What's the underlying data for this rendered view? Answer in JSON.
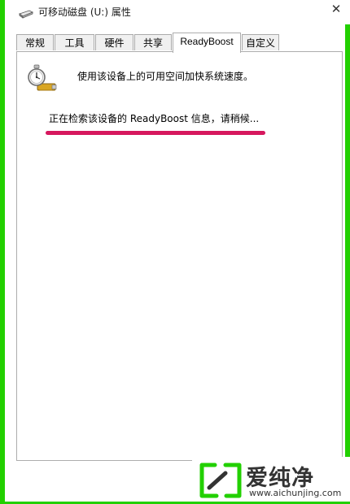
{
  "window": {
    "title": "可移动磁盘 (U:) 属性",
    "close_symbol": "✕"
  },
  "tabs": [
    {
      "label": "常规",
      "active": false
    },
    {
      "label": "工具",
      "active": false
    },
    {
      "label": "硬件",
      "active": false
    },
    {
      "label": "共享",
      "active": false
    },
    {
      "label": "ReadyBoost",
      "active": true
    },
    {
      "label": "自定义",
      "active": false
    }
  ],
  "readyboost": {
    "icon": "readyboost-icon",
    "description": "使用该设备上的可用空间加快系统速度。",
    "status": "正在检索该设备的 ReadyBoost 信息，请稍候..."
  },
  "watermark": {
    "brand": "爱纯净",
    "url": "www.aichunjing.com"
  },
  "colors": {
    "frame": "#22d000",
    "annotation": "#d6185e",
    "logo_green": "#22d000"
  }
}
